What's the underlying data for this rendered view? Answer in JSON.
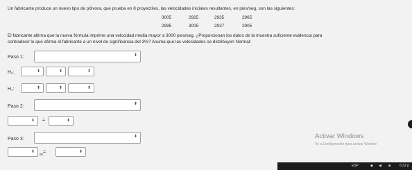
{
  "problem": {
    "intro": "Un fabricante produce un nuevo tipo de pólvora, que prueba en 8 proyectiles, las velocidades iniciales resultantes, en pies/seg, son las siguientes:",
    "velocities_row1": [
      "3005",
      "2925",
      "2935",
      "2965"
    ],
    "velocities_row2": [
      "2995",
      "3005",
      "2937",
      "2905"
    ],
    "question_line1": "El fabricante afirma que la nueva fórmula imprime una velocidad media mayor a 3000 pies/seg. ¿Proporcionan los datos de la muestra suficiente evidencia para",
    "question_line2": "contradecir lo que afirma el fabricante a un nivel de significancia del 3%? Asuma que las velocidades se distribuyen Normal:"
  },
  "form": {
    "paso1_label": "Paso 1:",
    "h0_label": "H₀:",
    "h1_label": "H₁:",
    "paso2_label": "Paso 2:",
    "equals": "=",
    "paso3_label": "Paso 3:",
    "sub_ep": "ep",
    "arrow": "⬍"
  },
  "watermark": {
    "title": "Activar Windows",
    "subtitle": "Ve a Configuración para activar Window"
  },
  "taskbar": {
    "lang": "ESP",
    "time": "6:32 p"
  }
}
